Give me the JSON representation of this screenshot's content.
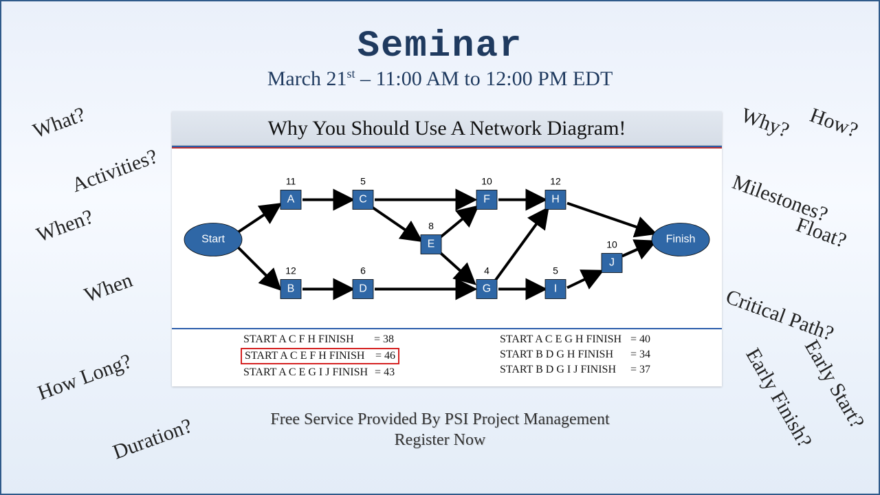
{
  "title": "Seminar",
  "subtitle_prefix": "March 21",
  "subtitle_suffix_super": "st",
  "subtitle_rest": " – 11:00 AM to 12:00 PM EDT",
  "footer1": "Free Service Provided By PSI Project Management",
  "footer2": "Register Now",
  "words": {
    "what": "What?",
    "activities": "Activities?",
    "when_q": "When?",
    "when": "When",
    "howlong": "How Long?",
    "duration": "Duration?",
    "why": "Why?",
    "how": "How?",
    "milestones": "Milestones?",
    "float": "Float?",
    "critpath": "Critical Path?",
    "earlyfinish": "Early Finish?",
    "earlystart": "Early Start?"
  },
  "diagram": {
    "title": "Why You Should Use A Network Diagram!",
    "start_label": "Start",
    "finish_label": "Finish",
    "nodes": {
      "A": {
        "label": "A",
        "dur": "11"
      },
      "B": {
        "label": "B",
        "dur": "12"
      },
      "C": {
        "label": "C",
        "dur": "5"
      },
      "D": {
        "label": "D",
        "dur": "6"
      },
      "E": {
        "label": "E",
        "dur": "8"
      },
      "F": {
        "label": "F",
        "dur": "10"
      },
      "G": {
        "label": "G",
        "dur": "4"
      },
      "H": {
        "label": "H",
        "dur": "12"
      },
      "I": {
        "label": "I",
        "dur": "5"
      },
      "J": {
        "label": "J",
        "dur": "10"
      }
    },
    "paths": [
      {
        "text": "START A C F H FINISH",
        "val": "= 38",
        "hl": false
      },
      {
        "text": "START A C E F H FINISH",
        "val": "= 46",
        "hl": true
      },
      {
        "text": "START A C E G I J FINISH",
        "val": "= 43",
        "hl": false
      },
      {
        "text": "START A C E G H FINISH",
        "val": "= 40",
        "hl": false
      },
      {
        "text": "START B D G H FINISH",
        "val": "= 34",
        "hl": false
      },
      {
        "text": "START B D G I J FINISH",
        "val": "= 37",
        "hl": false
      }
    ]
  }
}
